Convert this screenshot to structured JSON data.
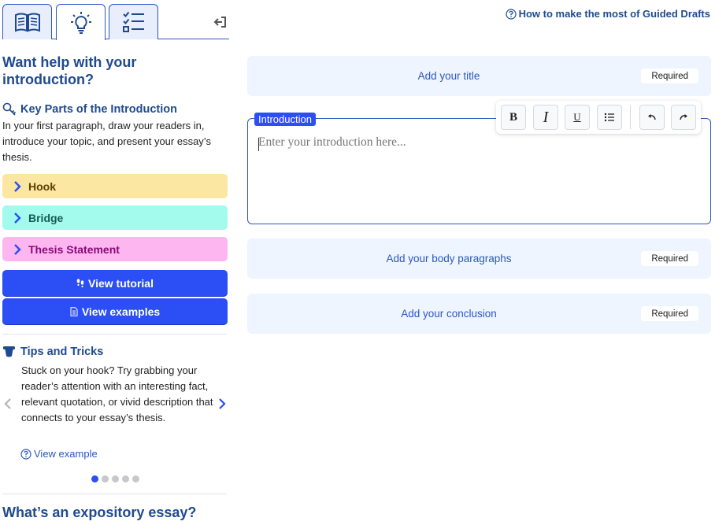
{
  "sidebar": {
    "tabs": [
      {
        "name": "book-icon"
      },
      {
        "name": "lightbulb-icon"
      },
      {
        "name": "checklist-icon"
      }
    ],
    "help_title": "Want help with your introduction?",
    "key_parts": {
      "title": "Key Parts of the Introduction",
      "description": "In your first paragraph, draw your readers in, introduce your topic, and present your essay’s thesis."
    },
    "accordions": [
      {
        "label": "Hook",
        "color": "#fbe6a2"
      },
      {
        "label": "Bridge",
        "color": "#a3fbee"
      },
      {
        "label": "Thesis Statement",
        "color": "#fdb6f0"
      }
    ],
    "buttons": {
      "tutorial": "View tutorial",
      "examples": "View examples"
    },
    "tips": {
      "title": "Tips and Tricks",
      "text": "Stuck on your hook? Try grabbing your reader’s attention with an interesting fact, relevant quotation, or vivid description that connects to your essay’s thesis.",
      "view_example": "View example",
      "current_slide": 1,
      "total_slides": 5
    },
    "expository_title": "What’s an expository essay?"
  },
  "main": {
    "help_link": "How to make the most of Guided Drafts",
    "title_card": {
      "label": "Add your title",
      "badge": "Required"
    },
    "introduction": {
      "tag": "Introduction",
      "placeholder": "Enter your introduction here..."
    },
    "toolbar": {
      "bold": "B",
      "italic": "I",
      "underline": "U"
    },
    "body_card": {
      "label": "Add your body paragraphs",
      "badge": "Required"
    },
    "conclusion_card": {
      "label": "Add your conclusion",
      "badge": "Required"
    }
  },
  "colors": {
    "accent": "#2c4ef5",
    "heading": "#1f4a8f",
    "card_bg": "#eef5fe"
  }
}
